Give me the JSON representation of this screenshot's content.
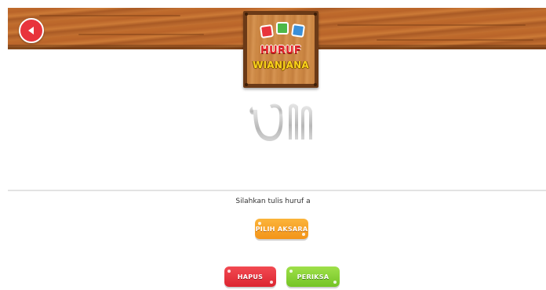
{
  "header": {
    "back_icon": "back-arrow-icon",
    "sign_title_line1": "HURUF",
    "sign_title_line2": "WIANJANA",
    "cube_icons": [
      "letter-cube-icon",
      "letter-cube-icon",
      "letter-cube-icon"
    ],
    "cube_colors": [
      "#e8343c",
      "#4cb848",
      "#3a8fd8"
    ]
  },
  "canvas": {
    "glyph_icon": "aksara-glyph-icon"
  },
  "controls": {
    "instruction": "Silahkan tulis huruf a",
    "pilih_label": "PILIH AKSARA",
    "hapus_label": "HAPUS",
    "periksa_label": "PERIKSA"
  },
  "colors": {
    "back_button": "#e8343c",
    "pilih_button": "#f39419",
    "hapus_button": "#dc2530",
    "periksa_button": "#74c425"
  }
}
